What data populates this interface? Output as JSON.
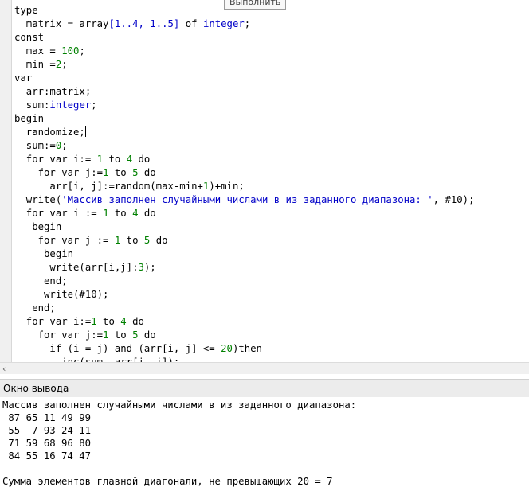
{
  "toolbar": {
    "run_tooltip": "Выполнить"
  },
  "editor": {
    "lines": [
      [
        {
          "t": "type",
          "c": "kw"
        }
      ],
      [
        {
          "t": "  matrix = array"
        },
        {
          "t": "[1..4, 1..5]",
          "c": "ty"
        },
        {
          "t": " of "
        },
        {
          "t": "integer",
          "c": "ty"
        },
        {
          "t": ";"
        }
      ],
      [
        {
          "t": "const",
          "c": "kw"
        }
      ],
      [
        {
          "t": "  max = "
        },
        {
          "t": "100",
          "c": "nm"
        },
        {
          "t": ";"
        }
      ],
      [
        {
          "t": "  min ="
        },
        {
          "t": "2",
          "c": "nm"
        },
        {
          "t": ";"
        }
      ],
      [
        {
          "t": "var",
          "c": "kw"
        }
      ],
      [
        {
          "t": "  arr:matrix;"
        }
      ],
      [
        {
          "t": "  sum:"
        },
        {
          "t": "integer",
          "c": "ty"
        },
        {
          "t": ";"
        }
      ],
      [
        {
          "t": "begin",
          "c": "kw"
        }
      ],
      [
        {
          "t": "  randomize;"
        }
      ],
      [
        {
          "t": "  sum:="
        },
        {
          "t": "0",
          "c": "nm"
        },
        {
          "t": ";"
        }
      ],
      [
        {
          "t": "  for var i:= "
        },
        {
          "t": "1",
          "c": "nm"
        },
        {
          "t": " to "
        },
        {
          "t": "4",
          "c": "nm"
        },
        {
          "t": " do"
        }
      ],
      [
        {
          "t": "    for var j:="
        },
        {
          "t": "1",
          "c": "nm"
        },
        {
          "t": " to "
        },
        {
          "t": "5",
          "c": "nm"
        },
        {
          "t": " do"
        }
      ],
      [
        {
          "t": "      arr[i, j]:=random(max-min+"
        },
        {
          "t": "1",
          "c": "nm"
        },
        {
          "t": ")+min;"
        }
      ],
      [
        {
          "t": "  write("
        },
        {
          "t": "'Массив заполнен случайными числами в из заданного диапазона: '",
          "c": "st"
        },
        {
          "t": ", #10);"
        }
      ],
      [
        {
          "t": "  for var i := "
        },
        {
          "t": "1",
          "c": "nm"
        },
        {
          "t": " to "
        },
        {
          "t": "4",
          "c": "nm"
        },
        {
          "t": " do"
        }
      ],
      [
        {
          "t": "   begin"
        }
      ],
      [
        {
          "t": "    for var j := "
        },
        {
          "t": "1",
          "c": "nm"
        },
        {
          "t": " to "
        },
        {
          "t": "5",
          "c": "nm"
        },
        {
          "t": " do"
        }
      ],
      [
        {
          "t": "     begin"
        }
      ],
      [
        {
          "t": "      write(arr[i,j]:"
        },
        {
          "t": "3",
          "c": "nm"
        },
        {
          "t": ");"
        }
      ],
      [
        {
          "t": "     end;"
        }
      ],
      [
        {
          "t": "     write(#10);"
        }
      ],
      [
        {
          "t": "   end;"
        }
      ],
      [
        {
          "t": "  for var i:="
        },
        {
          "t": "1",
          "c": "nm"
        },
        {
          "t": " to "
        },
        {
          "t": "4",
          "c": "nm"
        },
        {
          "t": " do"
        }
      ],
      [
        {
          "t": "    for var j:="
        },
        {
          "t": "1",
          "c": "nm"
        },
        {
          "t": " to "
        },
        {
          "t": "5",
          "c": "nm"
        },
        {
          "t": " do"
        }
      ],
      [
        {
          "t": "      if (i = j) and (arr[i, j] <= "
        },
        {
          "t": "20",
          "c": "nm"
        },
        {
          "t": ")then"
        }
      ],
      [
        {
          "t": "        inc(sum, arr[i, j]);"
        }
      ]
    ]
  },
  "output": {
    "title": "Окно вывода",
    "lines": [
      "Массив заполнен случайными числами в из заданного диапазона:",
      " 87 65 11 49 99",
      " 55  7 93 24 11",
      " 71 59 68 96 80",
      " 84 55 16 74 47",
      "",
      "Сумма элементов главной диагонали, не превышающих 20 = 7"
    ]
  },
  "scrollbar": {
    "left_arrow": "‹"
  }
}
